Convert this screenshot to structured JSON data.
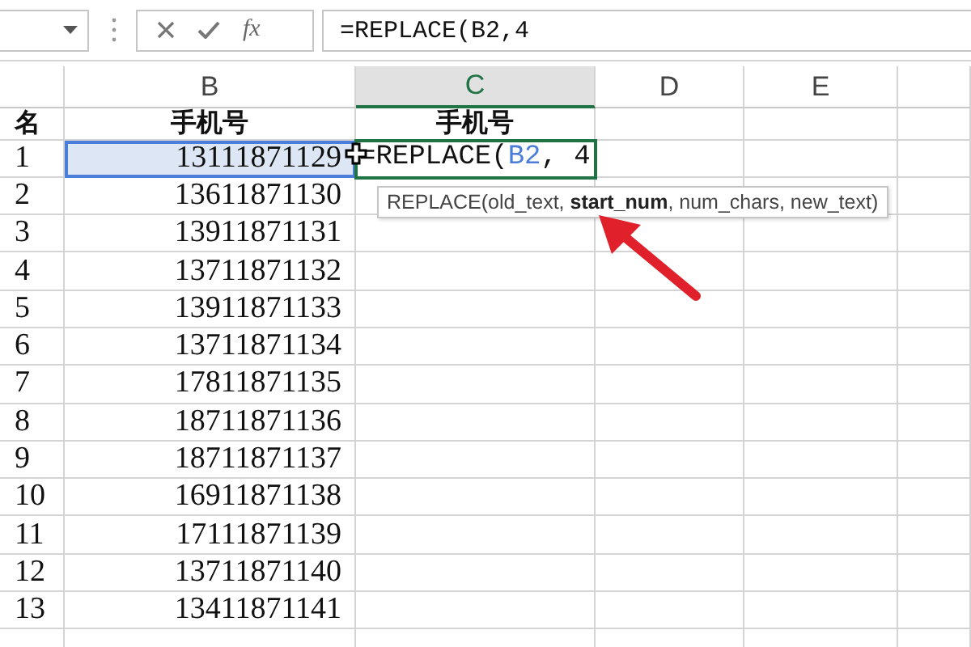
{
  "formula_bar": {
    "fx_label": "fx",
    "formula": "=REPLACE(B2,4"
  },
  "columns": [
    {
      "selected": false
    },
    {
      "letter": "B",
      "selected": false
    },
    {
      "letter": "C",
      "selected": true
    },
    {
      "letter": "D",
      "selected": false
    },
    {
      "letter": "E",
      "selected": false
    },
    {
      "selected": false
    }
  ],
  "header_row": [
    "名",
    "手机号",
    "手机号"
  ],
  "rows": [
    {
      "col_a": "1",
      "col_b": "13111871129",
      "referenced": true,
      "editing": {
        "before": "=REPLACE(",
        "ref": "B2",
        "after": ", 4"
      }
    },
    {
      "col_a": "2",
      "col_b": "13611871130",
      "referenced": false
    },
    {
      "col_a": "3",
      "col_b": "13911871131",
      "referenced": false
    },
    {
      "col_a": "4",
      "col_b": "13711871132",
      "referenced": false
    },
    {
      "col_a": "5",
      "col_b": "13911871133",
      "referenced": false
    },
    {
      "col_a": "6",
      "col_b": "13711871134",
      "referenced": false
    },
    {
      "col_a": "7",
      "col_b": "17811871135",
      "referenced": false
    },
    {
      "col_a": "8",
      "col_b": "18711871136",
      "referenced": false
    },
    {
      "col_a": "9",
      "col_b": "18711871137",
      "referenced": false
    },
    {
      "col_a": "10",
      "col_b": "16911871138",
      "referenced": false
    },
    {
      "col_a": "11",
      "col_b": "17111871139",
      "referenced": false
    },
    {
      "col_a": "12",
      "col_b": "13711871140",
      "referenced": false
    },
    {
      "col_a": "13",
      "col_b": "13411871141",
      "referenced": false
    }
  ],
  "tooltip": {
    "text": "REPLACE(old_text, **start_num**, num_chars, new_text)"
  }
}
